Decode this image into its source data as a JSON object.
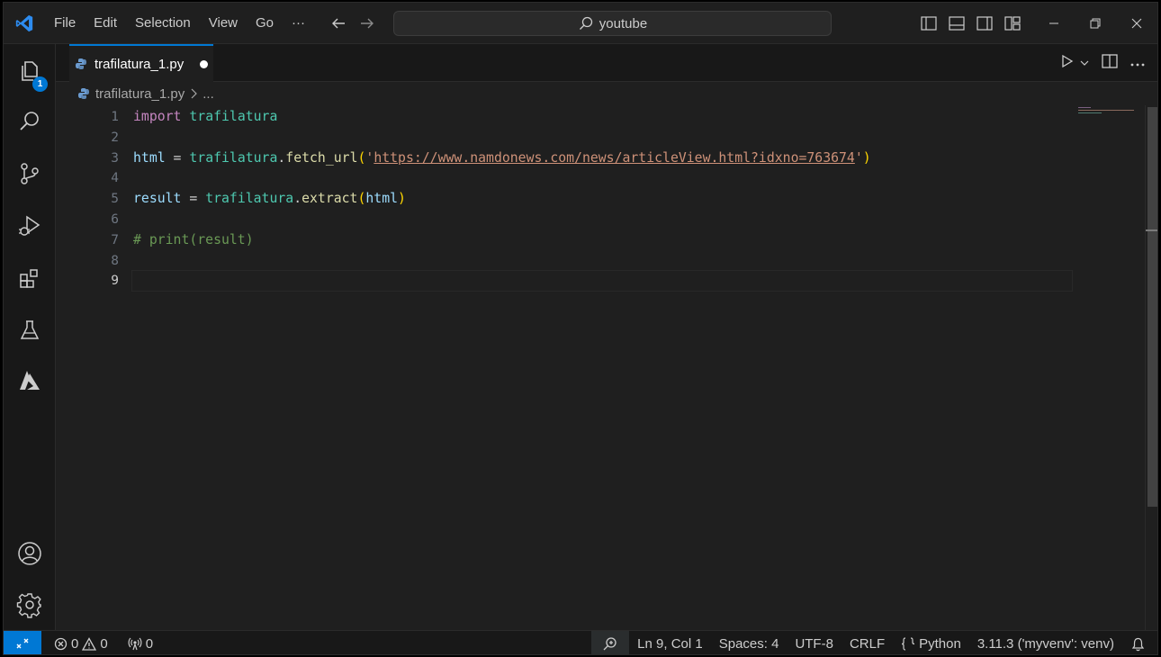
{
  "menu": {
    "items": [
      "File",
      "Edit",
      "Selection",
      "View",
      "Go",
      "···"
    ]
  },
  "search": {
    "text": "youtube"
  },
  "activity": {
    "explorer_badge": "1"
  },
  "tab": {
    "label": "trafilatura_1.py"
  },
  "breadcrumb": {
    "file": "trafilatura_1.py",
    "more": "..."
  },
  "editor": {
    "line_numbers": [
      "1",
      "2",
      "3",
      "4",
      "5",
      "6",
      "7",
      "8",
      "9"
    ],
    "active_line": "9",
    "line1": {
      "kw": "import",
      "mod": "trafilatura"
    },
    "line3": {
      "var": "html",
      "op": " = ",
      "mod": "trafilatura",
      "dot": ".",
      "fn": "fetch_url",
      "open": "(",
      "q1": "'",
      "url": "https://www.namdonews.com/news/articleView.html?idxno=763674",
      "q2": "'",
      "close": ")"
    },
    "line5": {
      "var": "result",
      "op": " = ",
      "mod": "trafilatura",
      "dot": ".",
      "fn": "extract",
      "open": "(",
      "arg": "html",
      "close": ")"
    },
    "line7": {
      "comment": "# print(result)"
    }
  },
  "status": {
    "errors": "0",
    "warnings": "0",
    "ports": "0",
    "cursor": "Ln 9, Col 1",
    "spaces": "Spaces: 4",
    "encoding": "UTF-8",
    "eol": "CRLF",
    "language": "Python",
    "interpreter": "3.11.3 ('myvenv': venv)"
  },
  "colors": {
    "accent": "#0078d4",
    "keyword": "#c586c0",
    "module": "#4ec9b0",
    "string": "#ce9178",
    "comment": "#6a9955"
  }
}
